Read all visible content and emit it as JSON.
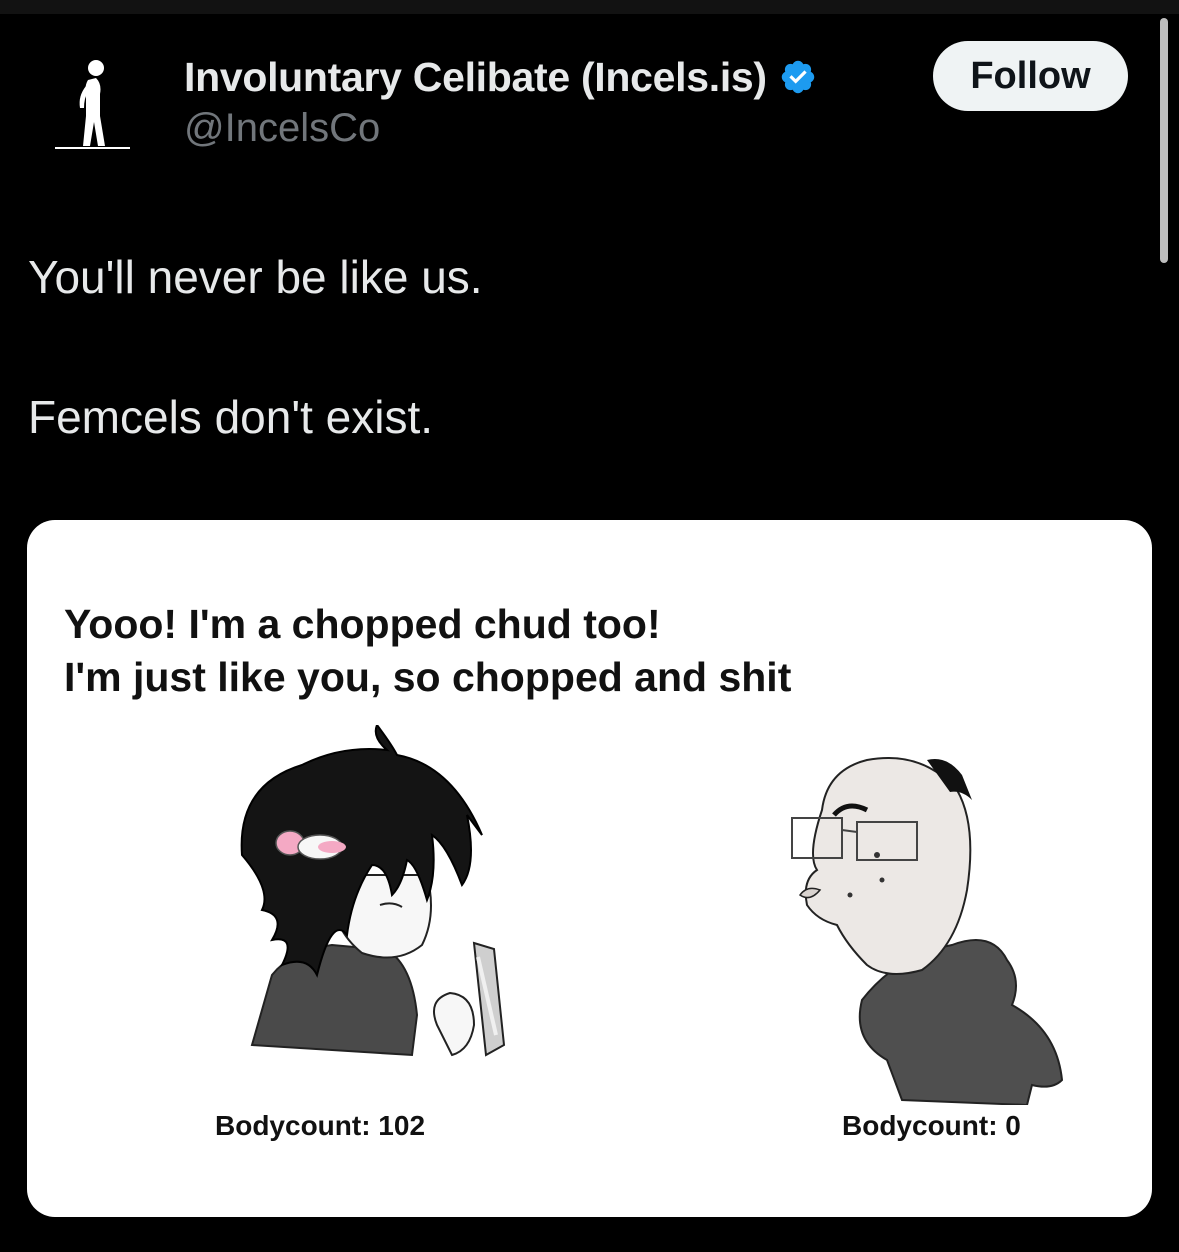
{
  "tweet": {
    "author": {
      "display_name": "Involuntary Celibate (Incels.is)",
      "handle": "@IncelsCo",
      "verified": true,
      "verified_icon": "verified-badge-icon",
      "avatar_icon": "standing-figure-logo"
    },
    "follow_label": "Follow",
    "text_lines": [
      "You'll never be like us.",
      "Femcels don't exist."
    ],
    "media": {
      "caption_lines": [
        "Yooo! I'm a chopped chud too!",
        "I'm just like you, so chopped and shit"
      ],
      "left_label": "Bodycount: 102",
      "right_label": "Bodycount: 0"
    }
  },
  "colors": {
    "background": "#000000",
    "primary_text": "#e7e9ea",
    "secondary_text": "#71767b",
    "verified_blue": "#1d9bf0",
    "follow_button_bg": "#eff3f4"
  }
}
